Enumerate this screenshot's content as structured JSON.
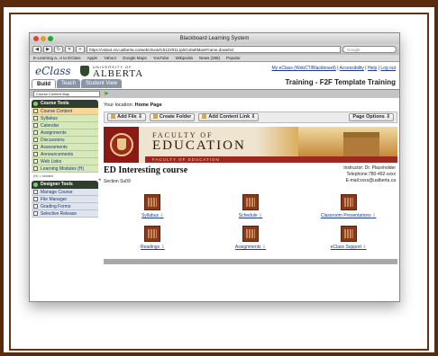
{
  "browser": {
    "window_title": "Blackboard Learning System",
    "url": "https://vista4.srv.ualberta.ca/webct/urw/lc5122011.tp0/cobaltMainFrame.dowebct",
    "search_placeholder": "Google",
    "bookmarks": [
      "E-Learning a...n to EClass",
      "Apple",
      "Yahoo!",
      "Google Maps",
      "YouTube",
      "Wikipedia",
      "News (286)",
      "Popular"
    ]
  },
  "header": {
    "eclass_logo": "eClass",
    "ua_small": "UNIVERSITY OF",
    "ua_big": "ALBERTA",
    "links_prefix": "My eClass (WebCT/Blackboard)",
    "link_accessibility": "Accessibility",
    "link_help": "Help",
    "link_logout": "Log out",
    "course_title": "Training - F2F Template Training"
  },
  "tabs": [
    {
      "label": "Build",
      "active": true
    },
    {
      "label": "Teach",
      "active": false
    },
    {
      "label": "Student View",
      "active": false
    }
  ],
  "nav": {
    "course_map_select": "Course Content Map"
  },
  "course_tools": {
    "heading": "Course Tools",
    "items": [
      {
        "label": "Course Content",
        "active": true
      },
      {
        "label": "Syllabus"
      },
      {
        "label": "Calendar"
      },
      {
        "label": "Assignments"
      },
      {
        "label": "Discussions"
      },
      {
        "label": "Assessments"
      },
      {
        "label": "Announcements"
      },
      {
        "label": "Web Links"
      },
      {
        "label": "Learning Modules (H)"
      }
    ],
    "note": "(H) = hidden"
  },
  "designer_tools": {
    "heading": "Designer Tools",
    "items": [
      {
        "label": "Manage Course"
      },
      {
        "label": "File Manager"
      },
      {
        "label": "Grading Forms"
      },
      {
        "label": "Selective Release"
      }
    ]
  },
  "content": {
    "location_prefix": "Your location:",
    "location": "Home Page",
    "buttons": {
      "add_file": "Add File",
      "create_folder": "Create Folder",
      "add_content_link": "Add Content Link",
      "page_options": "Page Options"
    },
    "banner": {
      "faculty": "FACULTY OF",
      "education": "EDUCATION",
      "strip": "FACULTY OF EDUCATION"
    },
    "course_name": "ED Interesting course",
    "section": "Section Su09",
    "instructor": "Instructor: Dr. Placeholder",
    "telephone": "Telephone:780-492-xxxx",
    "email": "E-mail:xxxx@ualberta.ca",
    "folders": [
      {
        "label": "Syllabus"
      },
      {
        "label": "Schedule"
      },
      {
        "label": "Classroom Presentations"
      },
      {
        "label": "Readings"
      },
      {
        "label": "Assignments"
      },
      {
        "label": "eClass Support"
      }
    ]
  }
}
